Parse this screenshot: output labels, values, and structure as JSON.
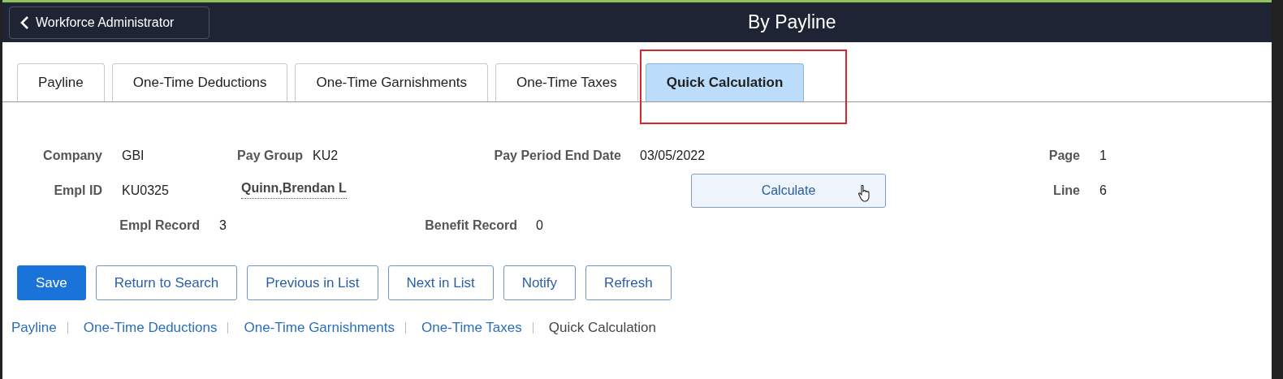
{
  "header": {
    "back_button": "Workforce Administrator",
    "title": "By Payline"
  },
  "tabs": [
    {
      "label": "Payline",
      "selected": false,
      "highlighted": false
    },
    {
      "label": "One-Time Deductions",
      "selected": false,
      "highlighted": false
    },
    {
      "label": "One-Time Garnishments",
      "selected": false,
      "highlighted": false
    },
    {
      "label": "One-Time Taxes",
      "selected": false,
      "highlighted": false
    },
    {
      "label": "Quick Calculation",
      "selected": true,
      "highlighted": true
    }
  ],
  "fields": {
    "company": {
      "label": "Company",
      "value": "GBI"
    },
    "pay_group": {
      "label": "Pay Group",
      "value": "KU2"
    },
    "pay_period_end_date": {
      "label": "Pay Period End Date",
      "value": "03/05/2022"
    },
    "page": {
      "label": "Page",
      "value": "1"
    },
    "empl_id": {
      "label": "Empl ID",
      "value": "KU0325"
    },
    "employee_name": "Quinn,Brendan L",
    "line": {
      "label": "Line",
      "value": "6"
    },
    "empl_record": {
      "label": "Empl Record",
      "value": "3"
    },
    "benefit_record": {
      "label": "Benefit Record",
      "value": "0"
    }
  },
  "calculate_button": "Calculate",
  "buttons": [
    {
      "label": "Save",
      "kind": "primary"
    },
    {
      "label": "Return to Search",
      "kind": "outline"
    },
    {
      "label": "Previous in List",
      "kind": "outline"
    },
    {
      "label": "Next in List",
      "kind": "outline"
    },
    {
      "label": "Notify",
      "kind": "outline"
    },
    {
      "label": "Refresh",
      "kind": "outline"
    }
  ],
  "links": [
    {
      "label": "Payline",
      "selected": false
    },
    {
      "label": "One-Time Deductions",
      "selected": false
    },
    {
      "label": "One-Time Garnishments",
      "selected": false
    },
    {
      "label": "One-Time Taxes",
      "selected": false
    },
    {
      "label": "Quick Calculation",
      "selected": true
    }
  ]
}
